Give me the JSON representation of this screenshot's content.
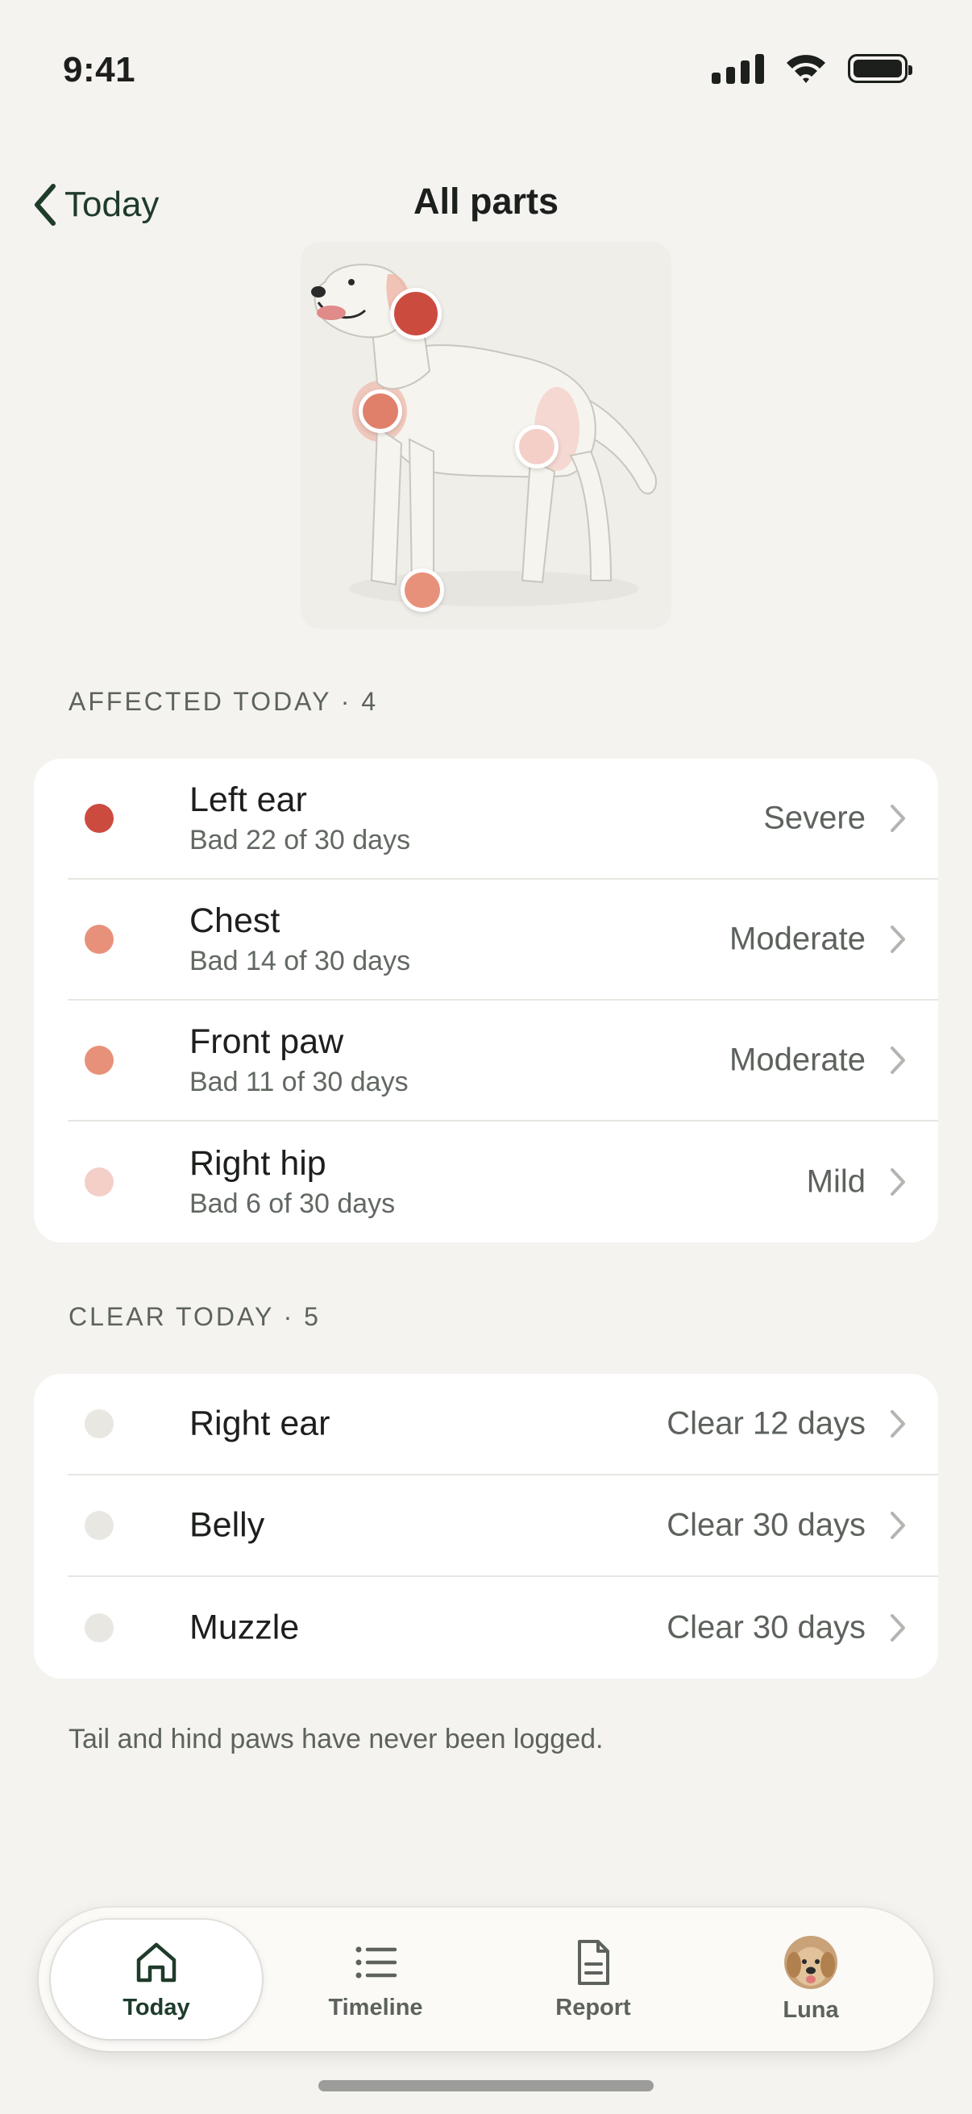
{
  "status_bar": {
    "time": "9:41"
  },
  "nav": {
    "back_label": "Today",
    "title": "All parts"
  },
  "colors": {
    "severe": "#cc4b3f",
    "moderate": "#e8917a",
    "mild": "#f4cfc8",
    "clear": "#e8e7e2",
    "accent": "#1f3b2a"
  },
  "affected": {
    "header": "AFFECTED TODAY · 4",
    "items": [
      {
        "name": "Left ear",
        "sub": "Bad 22 of 30 days",
        "status": "Severe",
        "level": "severe"
      },
      {
        "name": "Chest",
        "sub": "Bad 14 of 30 days",
        "status": "Moderate",
        "level": "moderate"
      },
      {
        "name": "Front paw",
        "sub": "Bad 11 of 30 days",
        "status": "Moderate",
        "level": "moderate"
      },
      {
        "name": "Right hip",
        "sub": "Bad 6 of 30 days",
        "status": "Mild",
        "level": "mild"
      }
    ]
  },
  "clear": {
    "header": "CLEAR TODAY · 5",
    "items": [
      {
        "name": "Right ear",
        "status": "Clear 12 days"
      },
      {
        "name": "Belly",
        "status": "Clear 30 days"
      },
      {
        "name": "Muzzle",
        "status": "Clear 30 days"
      }
    ]
  },
  "footnote": "Tail and hind paws have never been logged.",
  "tabs": [
    {
      "label": "Today",
      "icon": "home-icon",
      "active": true
    },
    {
      "label": "Timeline",
      "icon": "list-icon",
      "active": false
    },
    {
      "label": "Report",
      "icon": "document-icon",
      "active": false
    },
    {
      "label": "Luna",
      "icon": "dog-avatar",
      "active": false
    }
  ]
}
